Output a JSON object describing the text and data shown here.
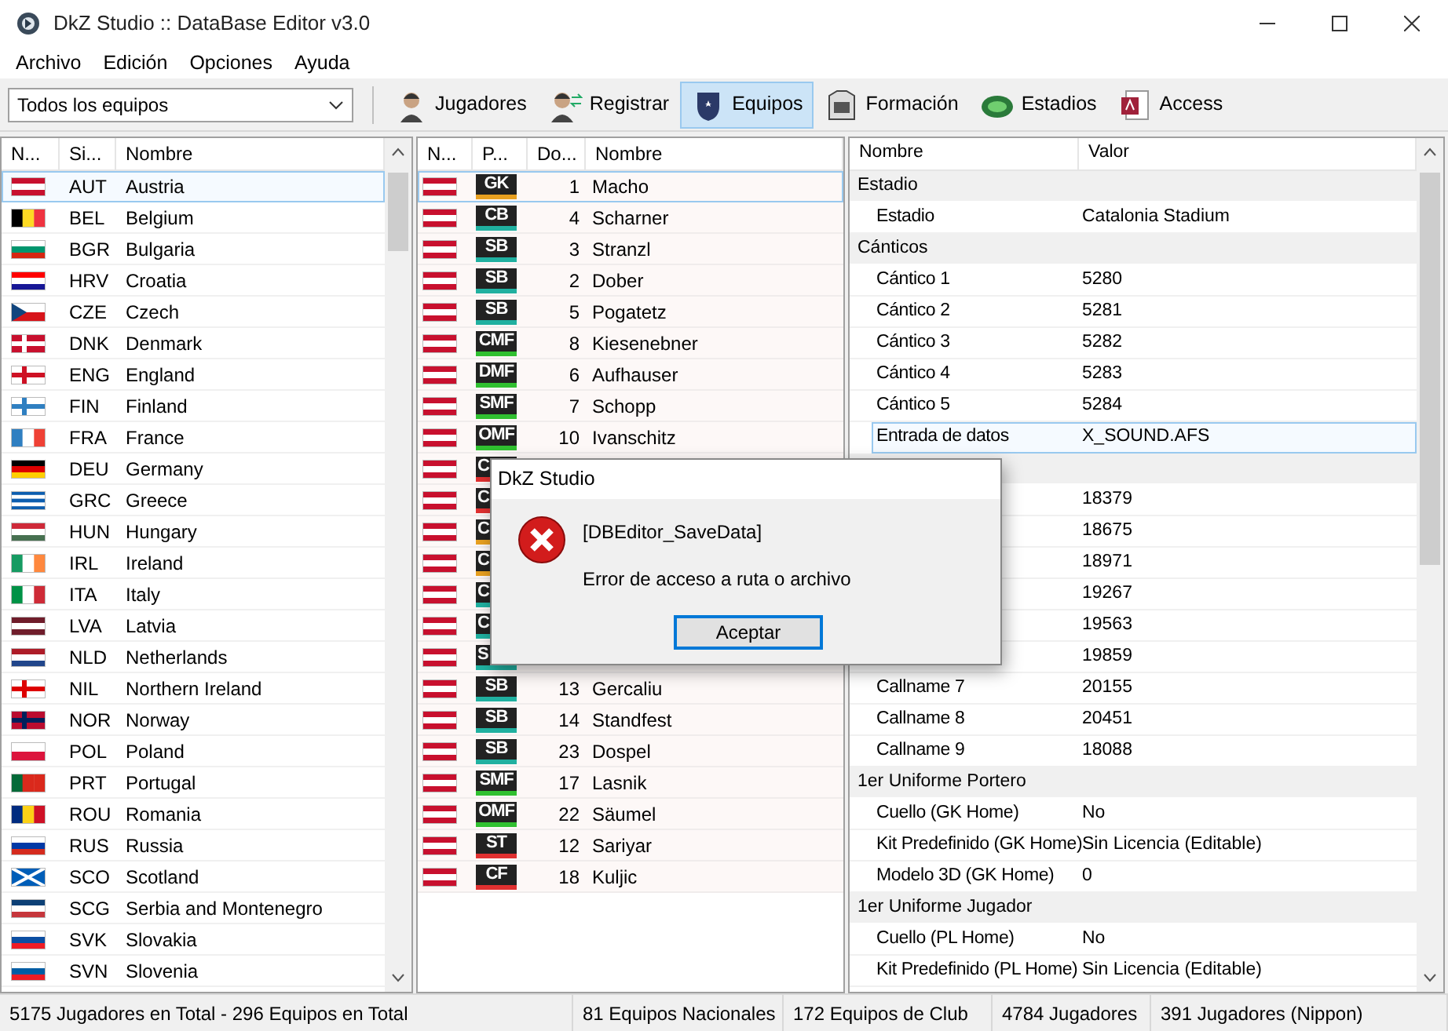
{
  "window": {
    "title": "DkZ Studio :: DataBase Editor v3.0"
  },
  "menu": [
    "Archivo",
    "Edición",
    "Opciones",
    "Ayuda"
  ],
  "filter": {
    "value": "Todos los equipos"
  },
  "toolbar": [
    {
      "label": "Jugadores",
      "selected": false
    },
    {
      "label": "Registrar",
      "selected": false
    },
    {
      "label": "Equipos",
      "selected": true
    },
    {
      "label": "Formación",
      "selected": false
    },
    {
      "label": "Estadios",
      "selected": false
    },
    {
      "label": "Access",
      "selected": false
    }
  ],
  "teams": {
    "columns": [
      "N...",
      "Si...",
      "Nombre"
    ],
    "rows": [
      {
        "code": "AUT",
        "name": "Austria",
        "selected": true
      },
      {
        "code": "BEL",
        "name": "Belgium",
        "selected": false
      },
      {
        "code": "BGR",
        "name": "Bulgaria",
        "selected": false
      },
      {
        "code": "HRV",
        "name": "Croatia",
        "selected": false
      },
      {
        "code": "CZE",
        "name": "Czech",
        "selected": false
      },
      {
        "code": "DNK",
        "name": "Denmark",
        "selected": false
      },
      {
        "code": "ENG",
        "name": "England",
        "selected": false
      },
      {
        "code": "FIN",
        "name": "Finland",
        "selected": false
      },
      {
        "code": "FRA",
        "name": "France",
        "selected": false
      },
      {
        "code": "DEU",
        "name": "Germany",
        "selected": false
      },
      {
        "code": "GRC",
        "name": "Greece",
        "selected": false
      },
      {
        "code": "HUN",
        "name": "Hungary",
        "selected": false
      },
      {
        "code": "IRL",
        "name": "Ireland",
        "selected": false
      },
      {
        "code": "ITA",
        "name": "Italy",
        "selected": false
      },
      {
        "code": "LVA",
        "name": "Latvia",
        "selected": false
      },
      {
        "code": "NLD",
        "name": "Netherlands",
        "selected": false
      },
      {
        "code": "NIL",
        "name": "Northern Ireland",
        "selected": false
      },
      {
        "code": "NOR",
        "name": "Norway",
        "selected": false
      },
      {
        "code": "POL",
        "name": "Poland",
        "selected": false
      },
      {
        "code": "PRT",
        "name": "Portugal",
        "selected": false
      },
      {
        "code": "ROU",
        "name": "Romania",
        "selected": false
      },
      {
        "code": "RUS",
        "name": "Russia",
        "selected": false
      },
      {
        "code": "SCO",
        "name": "Scotland",
        "selected": false
      },
      {
        "code": "SCG",
        "name": "Serbia and Montenegro",
        "selected": false
      },
      {
        "code": "SVK",
        "name": "Slovakia",
        "selected": false
      },
      {
        "code": "SVN",
        "name": "Slovenia",
        "selected": false
      }
    ]
  },
  "players": {
    "columns": [
      "N...",
      "P...",
      "Do...",
      "Nombre"
    ],
    "rows": [
      {
        "position": "GK",
        "color": "#e8a020",
        "number": "1",
        "name": "Macho",
        "selected": true
      },
      {
        "position": "CB",
        "color": "#20b0a0",
        "number": "4",
        "name": "Scharner",
        "selected": false
      },
      {
        "position": "SB",
        "color": "#20b0a0",
        "number": "3",
        "name": "Stranzl",
        "selected": false
      },
      {
        "position": "SB",
        "color": "#20b0a0",
        "number": "2",
        "name": "Dober",
        "selected": false
      },
      {
        "position": "SB",
        "color": "#20b0a0",
        "number": "5",
        "name": "Pogatetz",
        "selected": false
      },
      {
        "position": "CMF",
        "color": "#30c030",
        "number": "8",
        "name": "Kiesenebner",
        "selected": false
      },
      {
        "position": "DMF",
        "color": "#30c030",
        "number": "6",
        "name": "Aufhauser",
        "selected": false
      },
      {
        "position": "SMF",
        "color": "#30c030",
        "number": "7",
        "name": "Schopp",
        "selected": false
      },
      {
        "position": "OMF",
        "color": "#30c030",
        "number": "10",
        "name": "Ivanschitz",
        "selected": false
      },
      {
        "position": "C",
        "color": "#e03030",
        "selected": false
      },
      {
        "position": "C",
        "color": "#e03030",
        "selected": false
      },
      {
        "position": "C",
        "color": "#e8a020",
        "selected": false
      },
      {
        "position": "C",
        "color": "#e8a020",
        "selected": false
      },
      {
        "position": "C",
        "color": "#20b0a0",
        "selected": false
      },
      {
        "position": "C",
        "color": "#20b0a0",
        "selected": false
      },
      {
        "position": "S",
        "color": "#20b0a0",
        "selected": false
      },
      {
        "position": "SB",
        "color": "#20b0a0",
        "number": "13",
        "name": "Gercaliu",
        "selected": false
      },
      {
        "position": "SB",
        "color": "#20b0a0",
        "number": "14",
        "name": "Standfest",
        "selected": false
      },
      {
        "position": "SB",
        "color": "#20b0a0",
        "number": "23",
        "name": "Dospel",
        "selected": false
      },
      {
        "position": "SMF",
        "color": "#30c030",
        "number": "17",
        "name": "Lasnik",
        "selected": false
      },
      {
        "position": "OMF",
        "color": "#30c030",
        "number": "22",
        "name": "Säumel",
        "selected": false
      },
      {
        "position": "ST",
        "color": "#e03030",
        "number": "12",
        "name": "Sariyar",
        "selected": false
      },
      {
        "position": "CF",
        "color": "#e03030",
        "number": "18",
        "name": "Kuljic",
        "selected": false
      }
    ]
  },
  "properties": {
    "columns": [
      "Nombre",
      "Valor"
    ],
    "rows": [
      {
        "kind": "group",
        "name": "Estadio"
      },
      {
        "kind": "item",
        "name": "Estadio",
        "value": "Catalonia Stadium",
        "selected": false
      },
      {
        "kind": "group",
        "name": "Cánticos"
      },
      {
        "kind": "item",
        "name": "Cántico 1",
        "value": "5280",
        "selected": false
      },
      {
        "kind": "item",
        "name": "Cántico 2",
        "value": "5281",
        "selected": false
      },
      {
        "kind": "item",
        "name": "Cántico 3",
        "value": "5282",
        "selected": false
      },
      {
        "kind": "item",
        "name": "Cántico 4",
        "value": "5283",
        "selected": false
      },
      {
        "kind": "item",
        "name": "Cántico 5",
        "value": "5284",
        "selected": false
      },
      {
        "kind": "item",
        "name": "Entrada de datos",
        "value": "X_SOUND.AFS",
        "selected": true
      },
      {
        "kind": "group"
      },
      {
        "kind": "item",
        "value": "18379",
        "selected": false
      },
      {
        "kind": "item",
        "value": "18675",
        "selected": false
      },
      {
        "kind": "item",
        "value": "18971",
        "selected": false
      },
      {
        "kind": "item",
        "value": "19267",
        "selected": false
      },
      {
        "kind": "item",
        "value": "19563",
        "selected": false
      },
      {
        "kind": "item",
        "value": "19859",
        "selected": false
      },
      {
        "kind": "item",
        "name": "Callname 7",
        "value": "20155",
        "selected": false
      },
      {
        "kind": "item",
        "name": "Callname 8",
        "value": "20451",
        "selected": false
      },
      {
        "kind": "item",
        "name": "Callname 9",
        "value": "18088",
        "selected": false
      },
      {
        "kind": "group",
        "name": "1er Uniforme Portero"
      },
      {
        "kind": "item",
        "name": "Cuello (GK Home)",
        "value": "No",
        "selected": false
      },
      {
        "kind": "item",
        "name": "Kit Predefinido (GK Home)",
        "value": "Sin Licencia (Editable)",
        "selected": false
      },
      {
        "kind": "item",
        "name": "Modelo 3D (GK Home)",
        "value": "0",
        "selected": false
      },
      {
        "kind": "group",
        "name": "1er Uniforme Jugador"
      },
      {
        "kind": "item",
        "name": "Cuello (PL Home)",
        "value": "No",
        "selected": false
      },
      {
        "kind": "item",
        "name": "Kit Predefinido (PL Home)",
        "value": "Sin Licencia (Editable)",
        "selected": false
      }
    ]
  },
  "status_bar": [
    "5175 Jugadores en Total  -  296 Equipos en Total",
    "81 Equipos Nacionales",
    "172 Equipos de Club",
    "4784 Jugadores",
    "391 Jugadores (Nippon)"
  ],
  "dialog": {
    "title": "DkZ Studio",
    "heading": "[DBEditor_SaveData]",
    "message": "Error de acceso a ruta o archivo",
    "button": "Aceptar"
  }
}
